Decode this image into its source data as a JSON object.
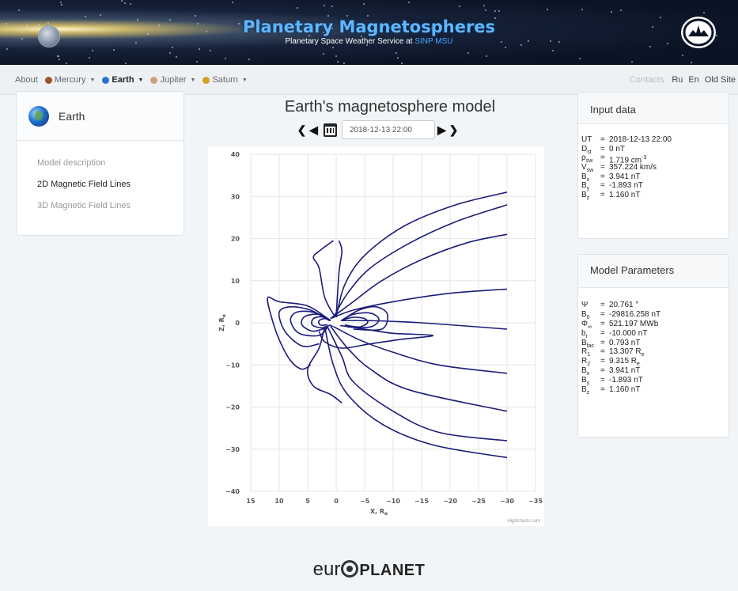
{
  "banner": {
    "title": "Planetary Magnetospheres",
    "subtitle_prefix": "Planetary Space Weather Service at ",
    "subtitle_highlight": "SINP MSU"
  },
  "nav": {
    "about": "About",
    "mercury": "Mercury",
    "earth": "Earth",
    "jupiter": "Jupiter",
    "saturn": "Saturn",
    "contacts": "Contacts",
    "ru": "Ru",
    "en": "En",
    "old_site": "Old Site"
  },
  "colors": {
    "mercury": "#a0522d",
    "earth": "#2a74c9",
    "jupiter": "#c9a37a",
    "saturn": "#d4a020",
    "field_line": "#1b1c7a"
  },
  "sidebar": {
    "title": "Earth",
    "items": [
      {
        "label": "Model description"
      },
      {
        "label": "2D Magnetic Field Lines"
      },
      {
        "label": "3D Magnetic Field Lines"
      }
    ]
  },
  "main": {
    "title": "Earth's magnetosphere model",
    "date_value": "2018-12-13 22:00"
  },
  "input_data": {
    "title": "Input data",
    "rows": [
      {
        "sym": "UT",
        "val": "2018-12-13 22:00"
      },
      {
        "sym": "D",
        "sub": "st",
        "val": "0 nT"
      },
      {
        "sym": "ρ",
        "sub": "sw",
        "val": "1.719 cm",
        "sup": "-3"
      },
      {
        "sym": "V",
        "sub": "sw",
        "val": "357.224 km/s"
      },
      {
        "sym": "B",
        "sub": "x",
        "val": "3.941 nT"
      },
      {
        "sym": "B",
        "sub": "y",
        "val": "-1.893 nT"
      },
      {
        "sym": "B",
        "sub": "z",
        "val": "1.160 nT"
      }
    ]
  },
  "model_params": {
    "title": "Model Parameters",
    "rows": [
      {
        "sym": "Ψ",
        "val": "20.761 °"
      },
      {
        "sym": "B",
        "sub": "0",
        "val": "-29816.258 nT"
      },
      {
        "sym": "Φ",
        "sub": "∞",
        "val": "521.197 MWb"
      },
      {
        "sym": "b",
        "sub": "r",
        "val": "-10.000 nT"
      },
      {
        "sym": "B",
        "sub": "fac",
        "val": "0.793 nT"
      },
      {
        "sym": "R",
        "sub": "1",
        "val": "13.307 R",
        "valsub": "e"
      },
      {
        "sym": "R",
        "sub": "2",
        "val": "9.315 R",
        "valsub": "e"
      },
      {
        "sym": "B",
        "sub": "x",
        "val": "3.941 nT"
      },
      {
        "sym": "B",
        "sub": "y",
        "val": "-1.893 nT"
      },
      {
        "sym": "B",
        "sub": "z",
        "val": "1.160 nT"
      }
    ]
  },
  "chart_data": {
    "type": "line",
    "xlabel": "X, R",
    "xlabel_sub": "e",
    "ylabel": "Z, R",
    "ylabel_sub": "e",
    "xlim": [
      15,
      -35
    ],
    "ylim": [
      -40,
      40
    ],
    "x_ticks": [
      15,
      10,
      5,
      0,
      -5,
      -10,
      -15,
      -20,
      -25,
      -30,
      -35
    ],
    "y_ticks": [
      40,
      30,
      20,
      10,
      0,
      -10,
      -20,
      -30,
      -40
    ],
    "grid": true,
    "credits": "Highcharts.com",
    "lines": [
      [
        [
          1,
          1
        ],
        [
          -3,
          5
        ],
        [
          -8,
          10
        ],
        [
          -15,
          15
        ],
        [
          -23,
          19
        ],
        [
          -30,
          21
        ]
      ],
      [
        [
          0.5,
          1.2
        ],
        [
          -2,
          7
        ],
        [
          -6,
          13
        ],
        [
          -13,
          19
        ],
        [
          -21,
          24
        ],
        [
          -30,
          28
        ]
      ],
      [
        [
          0,
          1.3
        ],
        [
          -1.5,
          9
        ],
        [
          -5,
          16
        ],
        [
          -12,
          23
        ],
        [
          -21,
          28
        ],
        [
          -30,
          31
        ]
      ],
      [
        [
          0,
          1.4
        ],
        [
          -0.5,
          12
        ],
        [
          -1,
          17
        ],
        [
          -0.5,
          19.5
        ]
      ],
      [
        [
          0.2,
          1.4
        ],
        [
          2,
          6
        ],
        [
          3,
          13
        ],
        [
          4,
          15.5
        ],
        [
          3,
          17
        ],
        [
          0.5,
          19.5
        ]
      ],
      [
        [
          1,
          1
        ],
        [
          -3,
          3
        ],
        [
          -10,
          5
        ],
        [
          -20,
          7
        ],
        [
          -30,
          8
        ]
      ],
      [
        [
          0.5,
          0.5
        ],
        [
          -6,
          0.5
        ],
        [
          -15,
          0
        ],
        [
          -30,
          -1.5
        ]
      ],
      [
        [
          1,
          -0.5
        ],
        [
          -4,
          -4
        ],
        [
          -10,
          -7
        ],
        [
          -18,
          -10
        ],
        [
          -30,
          -12
        ]
      ],
      [
        [
          1,
          -0.8
        ],
        [
          -2,
          -6
        ],
        [
          -6,
          -11
        ],
        [
          -13,
          -16
        ],
        [
          -30,
          -21
        ]
      ],
      [
        [
          1.5,
          -1
        ],
        [
          -1,
          -8
        ],
        [
          -3,
          -14
        ],
        [
          -10,
          -21
        ],
        [
          -18,
          -26
        ],
        [
          -30,
          -28
        ]
      ],
      [
        [
          2,
          -1
        ],
        [
          0.5,
          -10
        ],
        [
          -2,
          -17
        ],
        [
          -8,
          -24
        ],
        [
          -17,
          -29
        ],
        [
          -30,
          -32
        ]
      ],
      [
        [
          2,
          -0.8
        ],
        [
          3,
          -6
        ],
        [
          5,
          -11
        ],
        [
          4,
          -15
        ],
        [
          1,
          -17
        ],
        [
          -1,
          -19
        ]
      ],
      [
        [
          0,
          -0.5
        ],
        [
          -5,
          -1.5
        ],
        [
          -10,
          -2.5
        ],
        [
          -17,
          -3
        ],
        [
          -11,
          -4
        ],
        [
          -6,
          -5
        ],
        [
          -1,
          -6
        ],
        [
          2,
          -4.5
        ],
        [
          3,
          -2
        ]
      ],
      [
        [
          1,
          0.5
        ],
        [
          5,
          4
        ],
        [
          10,
          5
        ],
        [
          12,
          6
        ],
        [
          11.5,
          2
        ],
        [
          10,
          -4
        ],
        [
          8,
          -9
        ],
        [
          6,
          -11
        ],
        [
          4.5,
          -10
        ]
      ],
      [
        [
          1.2,
          0.5
        ],
        [
          4.5,
          3
        ],
        [
          8,
          3.8
        ],
        [
          10,
          2.5
        ],
        [
          9,
          -2
        ],
        [
          6,
          -5.5
        ],
        [
          3,
          -5
        ]
      ],
      [
        [
          1,
          0.5
        ],
        [
          4,
          2.5
        ],
        [
          7,
          2.5
        ],
        [
          8,
          0.5
        ],
        [
          6.5,
          -2.5
        ],
        [
          3,
          -3
        ],
        [
          1.5,
          -1
        ]
      ],
      [
        [
          1,
          0.6
        ],
        [
          3,
          2
        ],
        [
          5.5,
          1.5
        ],
        [
          6,
          -0.5
        ],
        [
          4,
          -2
        ],
        [
          1.5,
          -1
        ]
      ],
      [
        [
          1,
          0.5
        ],
        [
          2.5,
          1.4
        ],
        [
          4,
          1
        ],
        [
          4.2,
          -0.5
        ],
        [
          2.5,
          -1.2
        ],
        [
          1,
          -0.5
        ]
      ],
      [
        [
          1,
          0.5
        ],
        [
          2,
          1
        ],
        [
          3,
          0.5
        ],
        [
          2.8,
          -0.5
        ],
        [
          1.5,
          -0.5
        ]
      ],
      [
        [
          -1,
          0.6
        ],
        [
          -3,
          1.3
        ],
        [
          -5,
          1
        ],
        [
          -5.5,
          0
        ],
        [
          -4,
          -1
        ],
        [
          -1.5,
          -0.5
        ]
      ],
      [
        [
          -1,
          0.6
        ],
        [
          -3,
          2
        ],
        [
          -6,
          2.3
        ],
        [
          -7.5,
          0.8
        ],
        [
          -6,
          -1
        ],
        [
          -2,
          -1
        ]
      ],
      [
        [
          -1,
          0.6
        ],
        [
          -4,
          3
        ],
        [
          -7,
          3.8
        ],
        [
          -9,
          2
        ],
        [
          -8,
          -1.5
        ],
        [
          -3,
          -1.5
        ]
      ]
    ]
  },
  "footer": {
    "logo_left": "eur",
    "logo_right": "PLANET"
  }
}
